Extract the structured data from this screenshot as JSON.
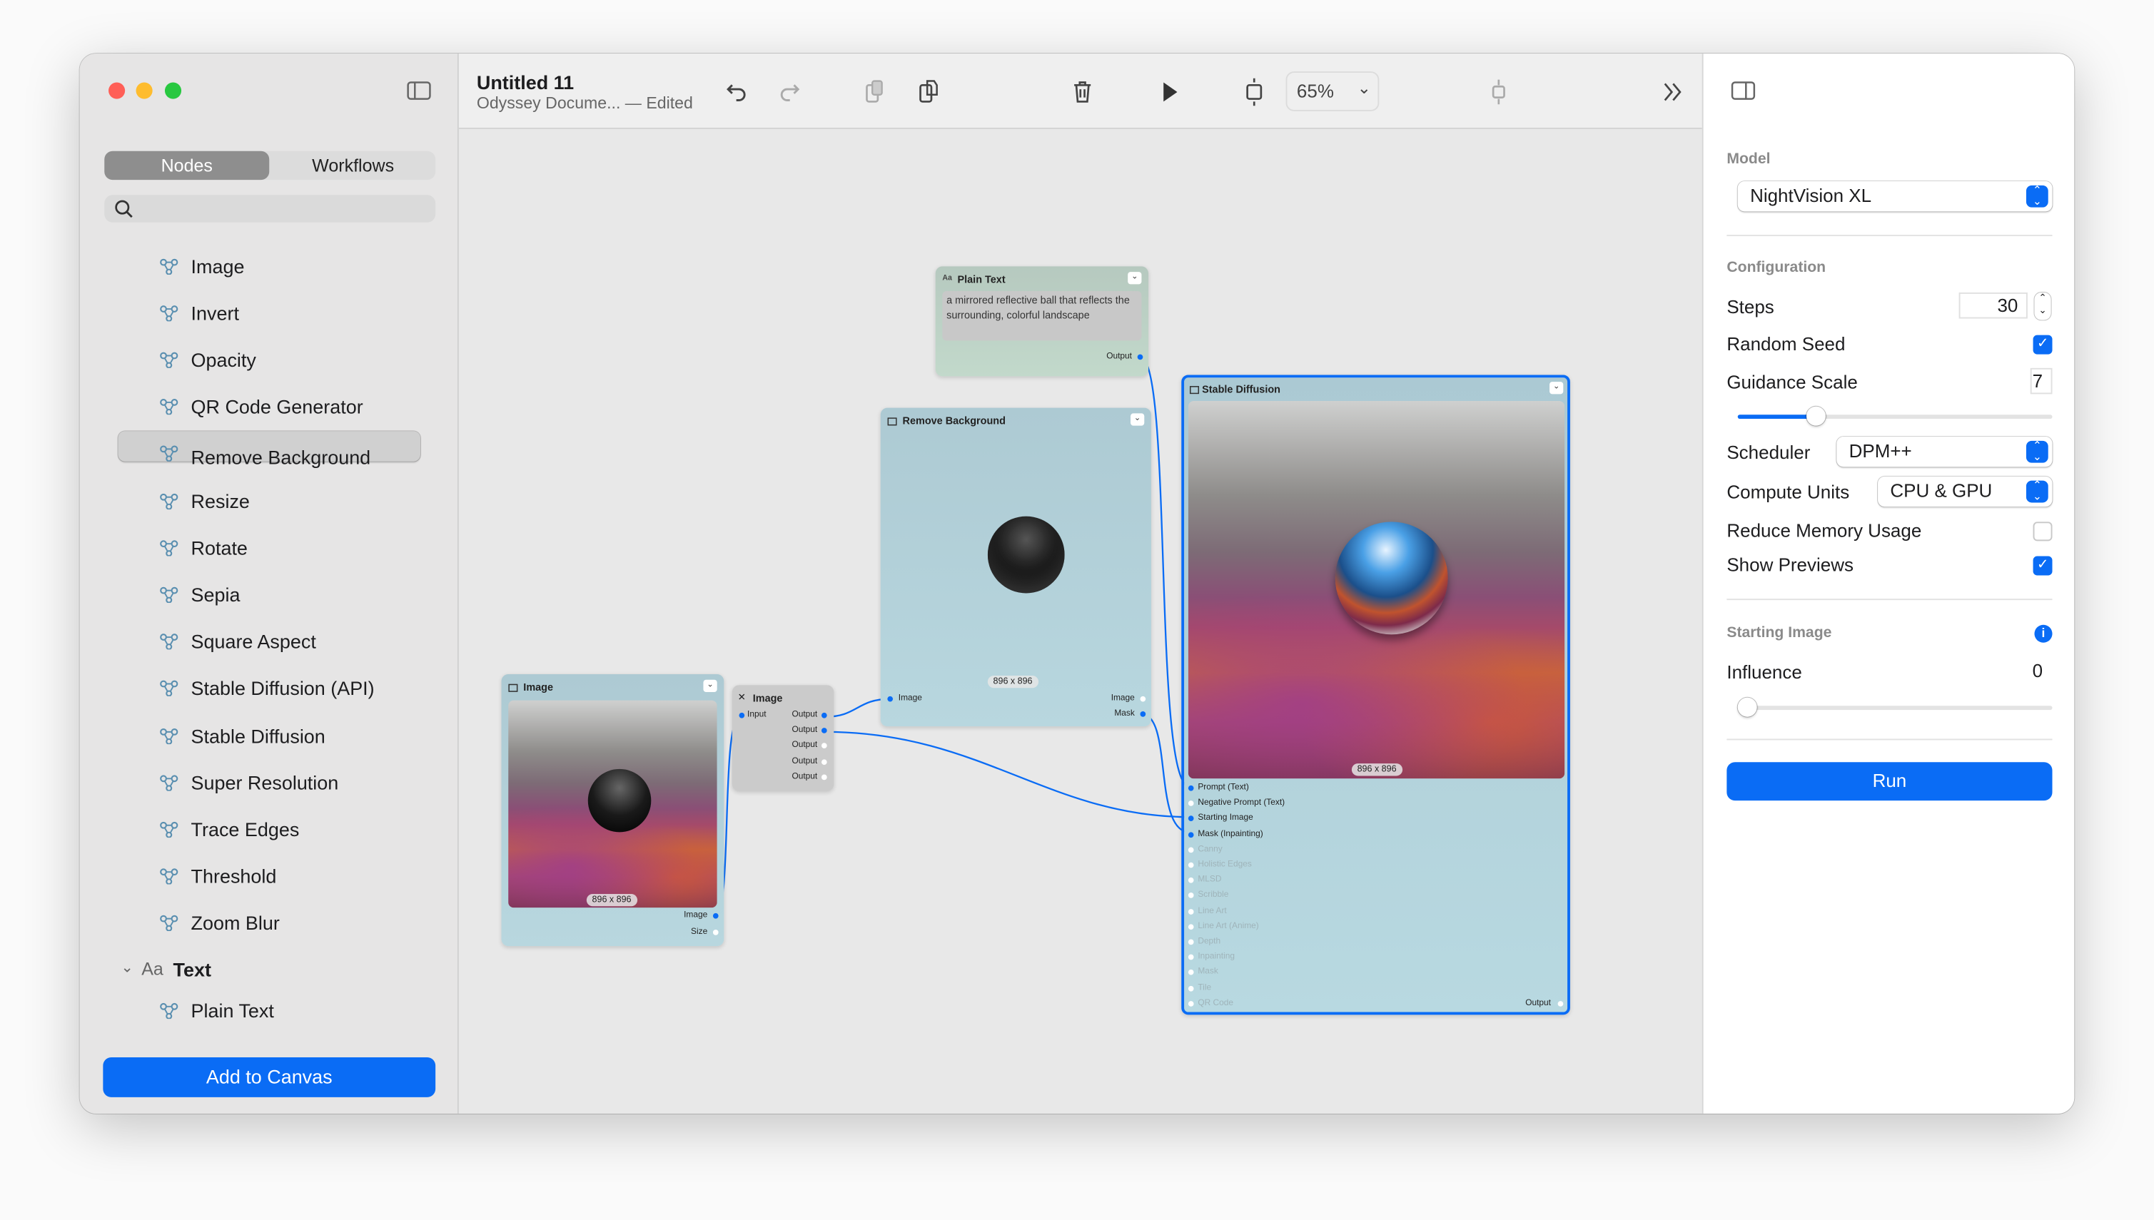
{
  "window": {
    "title": "Untitled 11",
    "subtitle": "Odyssey Docume... — Edited"
  },
  "sidebar": {
    "tabs": [
      {
        "label": "Nodes",
        "selected": true
      },
      {
        "label": "Workflows",
        "selected": false
      }
    ],
    "search_placeholder": "",
    "nodes": [
      "Image",
      "Invert",
      "Opacity",
      "QR Code Generator",
      "Remove Background",
      "Resize",
      "Rotate",
      "Sepia",
      "Square Aspect",
      "Stable Diffusion (API)",
      "Stable Diffusion",
      "Super Resolution",
      "Trace Edges",
      "Threshold",
      "Zoom Blur"
    ],
    "selected_node": "Remove Background",
    "group": {
      "icon": "Aa",
      "label": "Text",
      "expanded": true,
      "items": [
        "Plain Text"
      ]
    },
    "add_button": "Add to Canvas"
  },
  "toolbar": {
    "zoom": "65%",
    "icons": [
      "undo-icon",
      "redo-icon",
      "copy-icon",
      "paste-icon",
      "trash-icon",
      "play-icon",
      "fit-icon",
      "center-icon",
      "chevrons-right-icon"
    ]
  },
  "canvas": {
    "plain_text": {
      "icon": "Aa",
      "title": "Plain Text",
      "text": "a mirrored reflective ball that reflects the surrounding, colorful landscape",
      "output": "Output"
    },
    "remove_background": {
      "title": "Remove Background",
      "size": "896 x 896",
      "input": "Image",
      "outputs": [
        "Image",
        "Mask"
      ]
    },
    "image_source": {
      "title": "Image",
      "size": "896 x 896",
      "outputs": [
        "Image",
        "Size"
      ]
    },
    "image_util": {
      "title": "Image",
      "input": "Input",
      "outputs": [
        "Output",
        "Output",
        "Output",
        "Output",
        "Output"
      ]
    },
    "stable_diffusion": {
      "title": "Stable Diffusion",
      "size": "896 x 896",
      "inputs": [
        {
          "label": "Prompt (Text)",
          "connected": true
        },
        {
          "label": "Negative Prompt (Text)",
          "connected": false
        },
        {
          "label": "Starting Image",
          "connected": true
        },
        {
          "label": "Mask (Inpainting)",
          "connected": true
        },
        {
          "label": "Canny",
          "connected": false,
          "disabled": true
        },
        {
          "label": "Holistic Edges",
          "connected": false,
          "disabled": true
        },
        {
          "label": "MLSD",
          "connected": false,
          "disabled": true
        },
        {
          "label": "Scribble",
          "connected": false,
          "disabled": true
        },
        {
          "label": "Line Art",
          "connected": false,
          "disabled": true
        },
        {
          "label": "Line Art (Anime)",
          "connected": false,
          "disabled": true
        },
        {
          "label": "Depth",
          "connected": false,
          "disabled": true
        },
        {
          "label": "Inpainting",
          "connected": false,
          "disabled": true
        },
        {
          "label": "Mask",
          "connected": false,
          "disabled": true
        },
        {
          "label": "Tile",
          "connected": false,
          "disabled": true
        },
        {
          "label": "QR Code",
          "connected": false,
          "disabled": true
        }
      ],
      "output": "Output"
    }
  },
  "inspector": {
    "model_label": "Model",
    "model": "NightVision XL",
    "config_label": "Configuration",
    "steps_label": "Steps",
    "steps": "30",
    "random_seed_label": "Random Seed",
    "random_seed": true,
    "guidance_label": "Guidance Scale",
    "guidance": "7",
    "guidance_slider_fraction": 0.25,
    "scheduler_label": "Scheduler",
    "scheduler": "DPM++",
    "compute_label": "Compute Units",
    "compute": "CPU & GPU",
    "reduce_memory_label": "Reduce Memory Usage",
    "reduce_memory": false,
    "show_previews_label": "Show Previews",
    "show_previews": true,
    "starting_image_label": "Starting Image",
    "influence_label": "Influence",
    "influence": "0",
    "influence_slider_fraction": 0,
    "run_label": "Run"
  },
  "colors": {
    "accent": "#0a6cf5",
    "node_blue": "#b5d3dc",
    "node_green": "#bfd4c8"
  }
}
